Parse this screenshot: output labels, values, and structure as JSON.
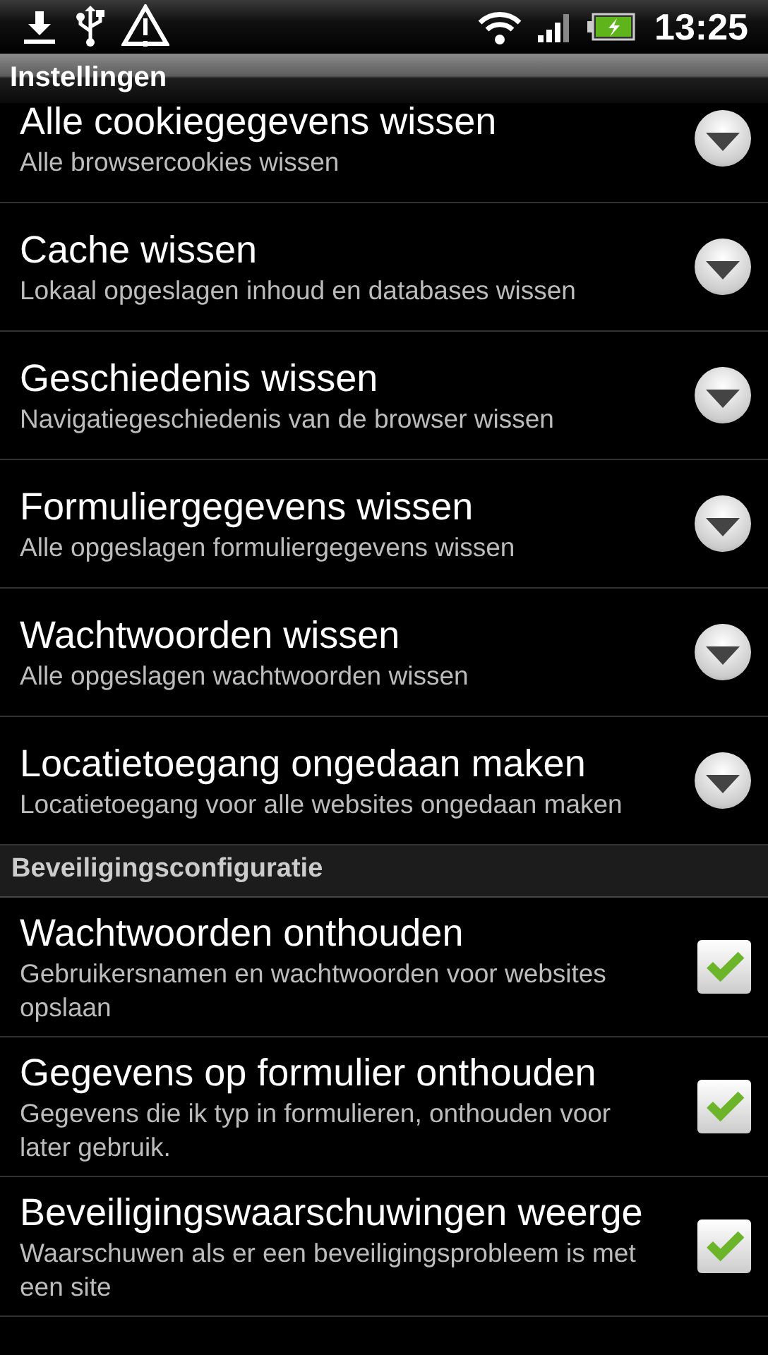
{
  "status_bar": {
    "time": "13:25"
  },
  "title_bar": {
    "title": "Instellingen"
  },
  "sections": [
    {
      "items": [
        {
          "kind": "dialog",
          "title": "Alle cookiegegevens wissen",
          "summary": "Alle browsercookies wissen"
        },
        {
          "kind": "dialog",
          "title": "Cache wissen",
          "summary": "Lokaal opgeslagen inhoud en databases wissen"
        },
        {
          "kind": "dialog",
          "title": "Geschiedenis wissen",
          "summary": "Navigatiegeschiedenis van de browser wissen"
        },
        {
          "kind": "dialog",
          "title": "Formuliergegevens wissen",
          "summary": "Alle opgeslagen formuliergegevens wissen"
        },
        {
          "kind": "dialog",
          "title": "Wachtwoorden wissen",
          "summary": "Alle opgeslagen wachtwoorden wissen"
        },
        {
          "kind": "dialog",
          "title": "Locatietoegang ongedaan maken",
          "summary": "Locatietoegang voor alle websites ongedaan maken"
        }
      ]
    },
    {
      "header": "Beveiligingsconfiguratie",
      "items": [
        {
          "kind": "checkbox",
          "title": "Wachtwoorden onthouden",
          "summary": "Gebruikersnamen en wachtwoorden voor websites opslaan",
          "checked": true
        },
        {
          "kind": "checkbox",
          "title": "Gegevens op formulier onthouden",
          "summary": "Gegevens die ik typ in formulieren, onthouden voor later gebruik.",
          "checked": true
        },
        {
          "kind": "checkbox",
          "title": "Beveiligingswaarschuwingen weerge",
          "summary": "Waarschuwen als er een beveiligingsprobleem is met een site",
          "checked": true
        }
      ]
    }
  ]
}
